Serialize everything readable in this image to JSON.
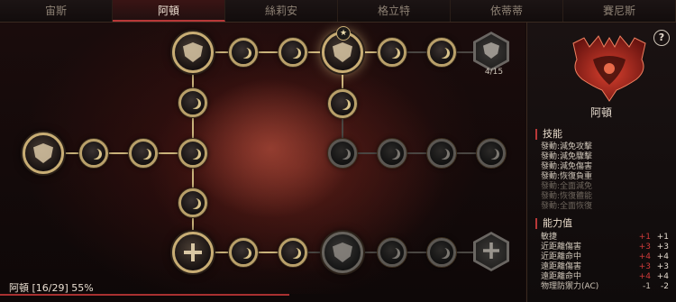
{
  "tabs": [
    "宙斯",
    "阿頓",
    "絲莉安",
    "格立特",
    "依蒂蒂",
    "賽尼斯"
  ],
  "active_tab": "阿頓",
  "tree": {
    "star_badge": "★",
    "counter": "4/15",
    "footer": "阿頓 [16/29] 55%",
    "progress": 0.55
  },
  "panel": {
    "help": "?",
    "character": "阿頓",
    "skills_title": "技能",
    "skills": [
      {
        "label": "發動:減免攻擊",
        "unlocked": true
      },
      {
        "label": "發動:減免驟擊",
        "unlocked": true
      },
      {
        "label": "發動:減免傷害",
        "unlocked": true
      },
      {
        "label": "發動:恢復負重",
        "unlocked": true
      },
      {
        "label": "發動:全面減免",
        "unlocked": false
      },
      {
        "label": "發動:恢復體能",
        "unlocked": false
      },
      {
        "label": "發動:全面恢復",
        "unlocked": false
      }
    ],
    "stats_title": "能力值",
    "stats": [
      {
        "label": "敏捷",
        "delta": "+1",
        "value": "+1"
      },
      {
        "label": "近距離傷害",
        "delta": "+3",
        "value": "+3"
      },
      {
        "label": "近距離命中",
        "delta": "+4",
        "value": "+4"
      },
      {
        "label": "遠距離傷害",
        "delta": "+3",
        "value": "+3"
      },
      {
        "label": "遠距離命中",
        "delta": "+4",
        "value": "+4"
      },
      {
        "label": "物理防禦力(AC)",
        "delta": "-1",
        "value": "-2"
      }
    ]
  },
  "colors": {
    "accent": "#b83838",
    "gold": "#c8ad74",
    "locked": "#5b5752"
  }
}
